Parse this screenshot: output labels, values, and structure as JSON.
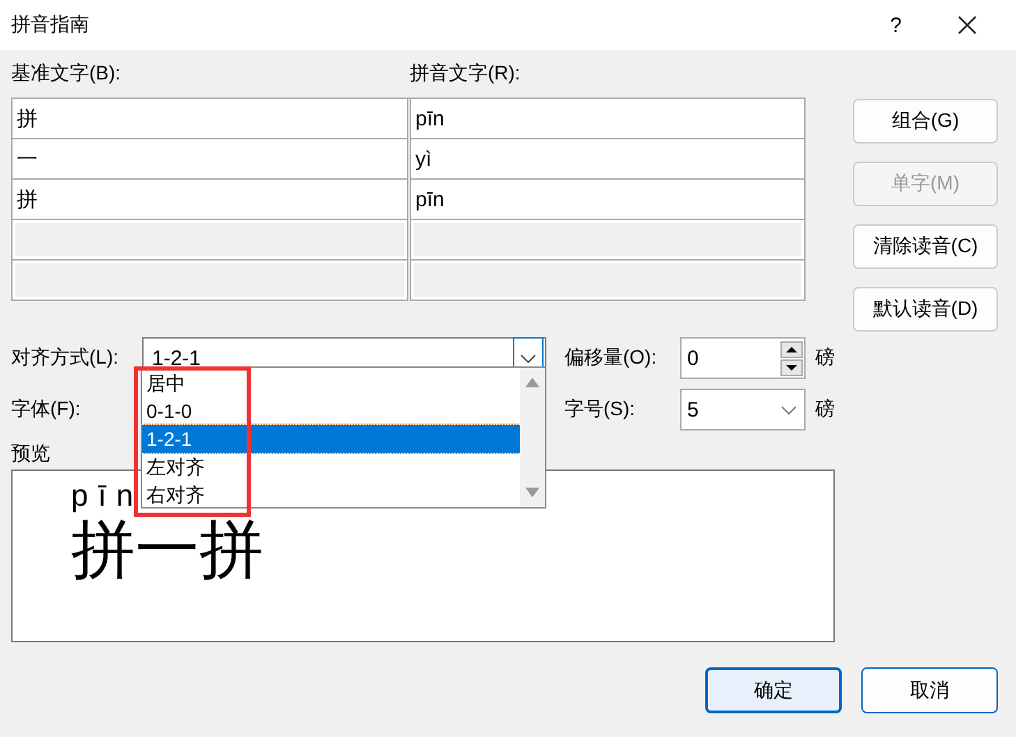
{
  "window": {
    "title": "拼音指南",
    "help": "?"
  },
  "base_label": "基准文字(B):",
  "ruby_label": "拼音文字(R):",
  "rows": [
    {
      "kind": "filled",
      "base": "拼",
      "ruby": "pīn"
    },
    {
      "kind": "filled",
      "base": "一",
      "ruby": "yì"
    },
    {
      "kind": "filled",
      "base": "拼",
      "ruby": "pīn"
    },
    {
      "kind": "empty"
    },
    {
      "kind": "empty"
    }
  ],
  "side_buttons": [
    {
      "label": "组合(G)",
      "disabled": false
    },
    {
      "label": "单字(M)",
      "disabled": true
    },
    {
      "label": "清除读音(C)",
      "disabled": false
    },
    {
      "label": "默认读音(D)",
      "disabled": false
    }
  ],
  "alignment": {
    "label": "对齐方式(L):",
    "value": "1-2-1",
    "expanded": true,
    "options": [
      {
        "label": "居中",
        "selected": false
      },
      {
        "label": "0-1-0",
        "selected": false
      },
      {
        "label": "1-2-1",
        "selected": true
      },
      {
        "label": "左对齐",
        "selected": false
      },
      {
        "label": "右对齐",
        "selected": false
      }
    ]
  },
  "offset": {
    "label": "偏移量(O):",
    "value": "0",
    "unit": "磅"
  },
  "font": {
    "label": "字体(F):"
  },
  "size": {
    "label": "字号(S):",
    "value": "5",
    "unit": "磅"
  },
  "preview": {
    "label": "预览",
    "ruby": "pīn",
    "base": "拼一拼"
  },
  "footer_buttons": [
    {
      "label": "确定",
      "default": true
    },
    {
      "label": "取消",
      "default": false
    }
  ]
}
